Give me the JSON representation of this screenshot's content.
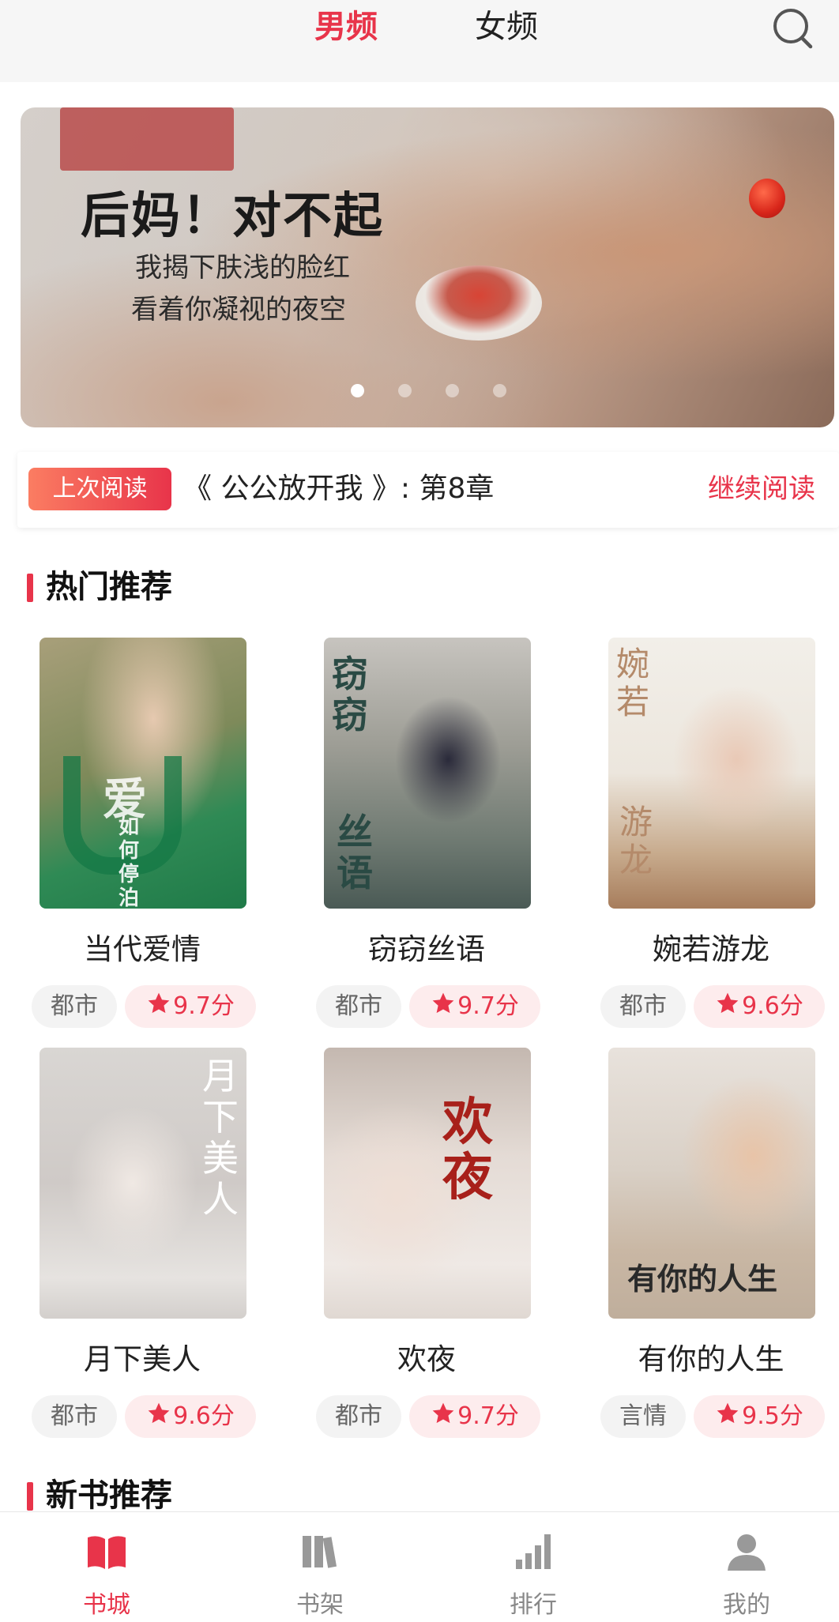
{
  "header": {
    "tabs": [
      {
        "label": "男频",
        "active": true
      },
      {
        "label": "女频",
        "active": false
      }
    ],
    "search_icon": "search-icon"
  },
  "banner": {
    "title": "后妈！对不起",
    "subtitle_line1": "我揭下肤浅的脸红",
    "subtitle_line2": "看着你凝视的夜空",
    "slide_count": 4,
    "active_slide": 1
  },
  "last_read": {
    "badge": "上次阅读",
    "book": "《 公公放开我 》: 第8章",
    "continue_label": "继续阅读"
  },
  "sections": {
    "hot": "热门推荐",
    "new": "新书推荐"
  },
  "hot_books": [
    {
      "title": "当代爱情",
      "genre": "都市",
      "score": "9.7分",
      "cover_text": "爱 如何 停泊"
    },
    {
      "title": "窃窃丝语",
      "genre": "都市",
      "score": "9.7分",
      "cover_text": "窃窃 丝语"
    },
    {
      "title": "婉若游龙",
      "genre": "都市",
      "score": "9.6分",
      "cover_text": "婉若 游龙"
    },
    {
      "title": "月下美人",
      "genre": "都市",
      "score": "9.6分",
      "cover_text": "月下美人"
    },
    {
      "title": "欢夜",
      "genre": "都市",
      "score": "9.7分",
      "cover_text": "欢夜"
    },
    {
      "title": "有你的人生",
      "genre": "言情",
      "score": "9.5分",
      "cover_text": "有你的人生"
    }
  ],
  "bottom_nav": [
    {
      "label": "书城",
      "icon": "book-open-icon",
      "active": true
    },
    {
      "label": "书架",
      "icon": "bookshelf-icon",
      "active": false
    },
    {
      "label": "排行",
      "icon": "bar-chart-icon",
      "active": false
    },
    {
      "label": "我的",
      "icon": "user-icon",
      "active": false
    }
  ],
  "colors": {
    "accent": "#e8344a",
    "score_bg": "#fdeced",
    "genre_bg": "#f3f3f3",
    "header_bg": "#f6f6f6"
  }
}
